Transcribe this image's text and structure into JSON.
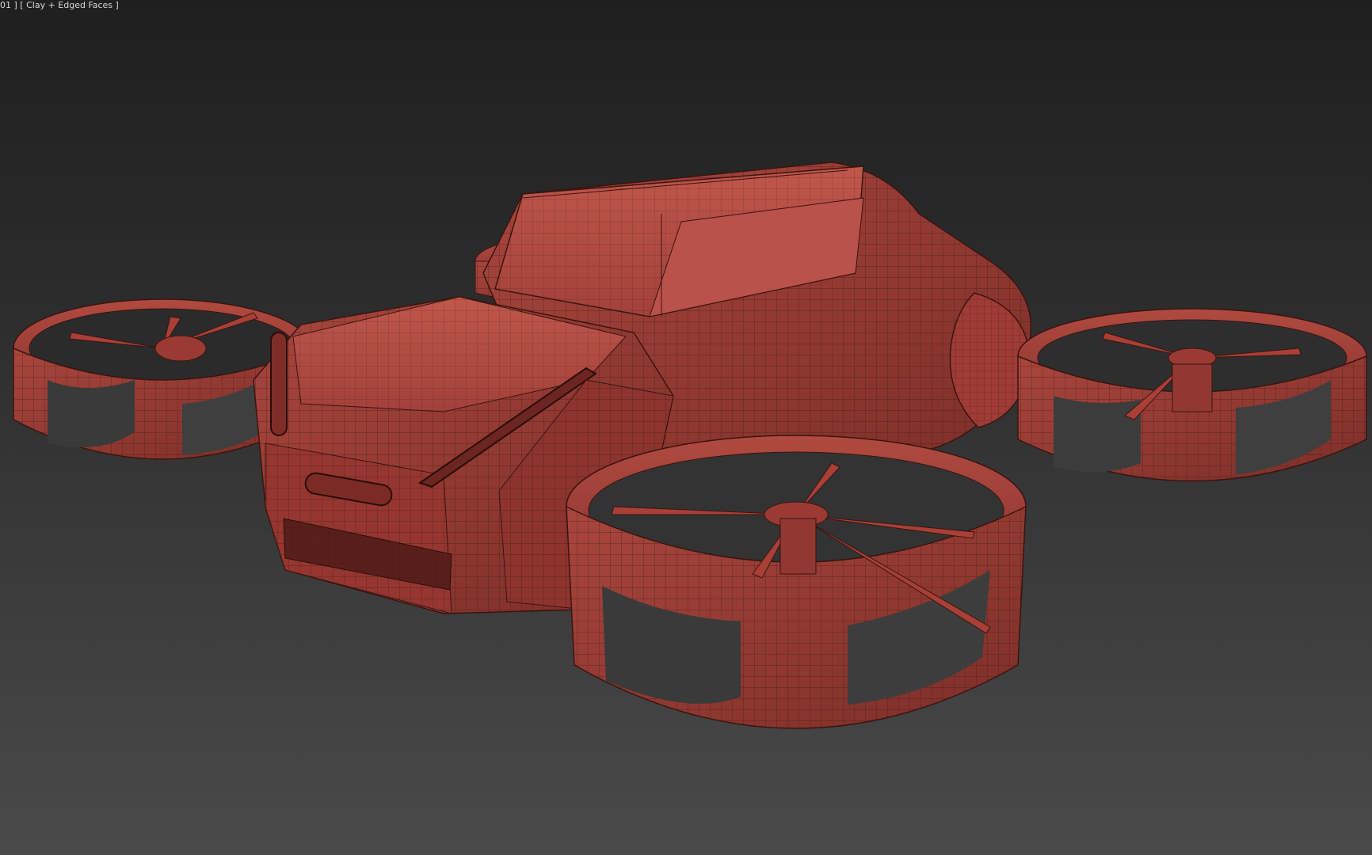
{
  "viewport": {
    "label_prefix": "01 ]",
    "shading_mode": "[ Clay + Edged Faces ]",
    "background_top": "#1f1f1f",
    "background_bottom": "#4a4a4a",
    "model_color": "#a84038",
    "wire_color": "#3a1410"
  }
}
